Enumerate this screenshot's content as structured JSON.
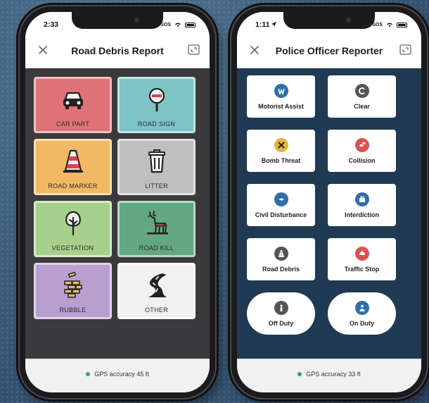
{
  "colors": {
    "car_part": "#e07377",
    "road_sign": "#7ec3c5",
    "road_marker": "#f2b964",
    "litter": "#bfbfbf",
    "vegetation": "#a7d08c",
    "road_kill": "#63a882",
    "rubble": "#b89fd0",
    "other": "#f1f1f1",
    "gps_dot": "#3aa35a",
    "police_bg": "#1f3a52",
    "debris_bg": "#3a3a3c"
  },
  "left_phone": {
    "status": {
      "time": "2:33",
      "sos": "SOS"
    },
    "header": {
      "title": "Road Debris Report",
      "close_icon": "close-icon",
      "expand_icon": "expand-icon"
    },
    "tiles": [
      {
        "label": "CAR PART",
        "icon": "car-icon"
      },
      {
        "label": "ROAD SIGN",
        "icon": "no-entry-sign-icon"
      },
      {
        "label": "ROAD MARKER",
        "icon": "traffic-cone-icon"
      },
      {
        "label": "LITTER",
        "icon": "trash-can-icon"
      },
      {
        "label": "VEGETATION",
        "icon": "tree-icon"
      },
      {
        "label": "ROAD KILL",
        "icon": "deer-icon"
      },
      {
        "label": "RUBBLE",
        "icon": "bricks-icon"
      },
      {
        "label": "OTHER",
        "icon": "road-icon"
      }
    ],
    "footer": {
      "gps": "GPS accuracy 45 ft"
    }
  },
  "right_phone": {
    "status": {
      "time": "1:11",
      "sos": "SOS"
    },
    "header": {
      "title": "Police Officer Reporter",
      "close_icon": "close-icon",
      "expand_icon": "expand-icon"
    },
    "buttons": [
      {
        "label": "Motorist Assist",
        "icon": "motorist-assist-icon",
        "color": "#2f6fa8"
      },
      {
        "label": "Clear",
        "icon": "clear-icon",
        "color": "#555555"
      },
      {
        "label": "Bomb Threat",
        "icon": "bomb-threat-icon",
        "color": "#e2b53b"
      },
      {
        "label": "Collision",
        "icon": "collision-icon",
        "color": "#d9534f"
      },
      {
        "label": "Civil Disturbance",
        "icon": "civil-disturbance-icon",
        "color": "#2f6fa8"
      },
      {
        "label": "Interdiction",
        "icon": "interdiction-icon",
        "color": "#2f6fa8"
      },
      {
        "label": "Road Debris",
        "icon": "road-debris-icon",
        "color": "#555555"
      },
      {
        "label": "Traffic Stop",
        "icon": "traffic-stop-icon",
        "color": "#d9534f"
      },
      {
        "label": "Off Duty",
        "icon": "off-duty-icon",
        "color": "#555555"
      },
      {
        "label": "On Duty",
        "icon": "on-duty-icon",
        "color": "#2f6fa8"
      }
    ],
    "footer": {
      "gps": "GPS accuracy 33 ft"
    }
  }
}
